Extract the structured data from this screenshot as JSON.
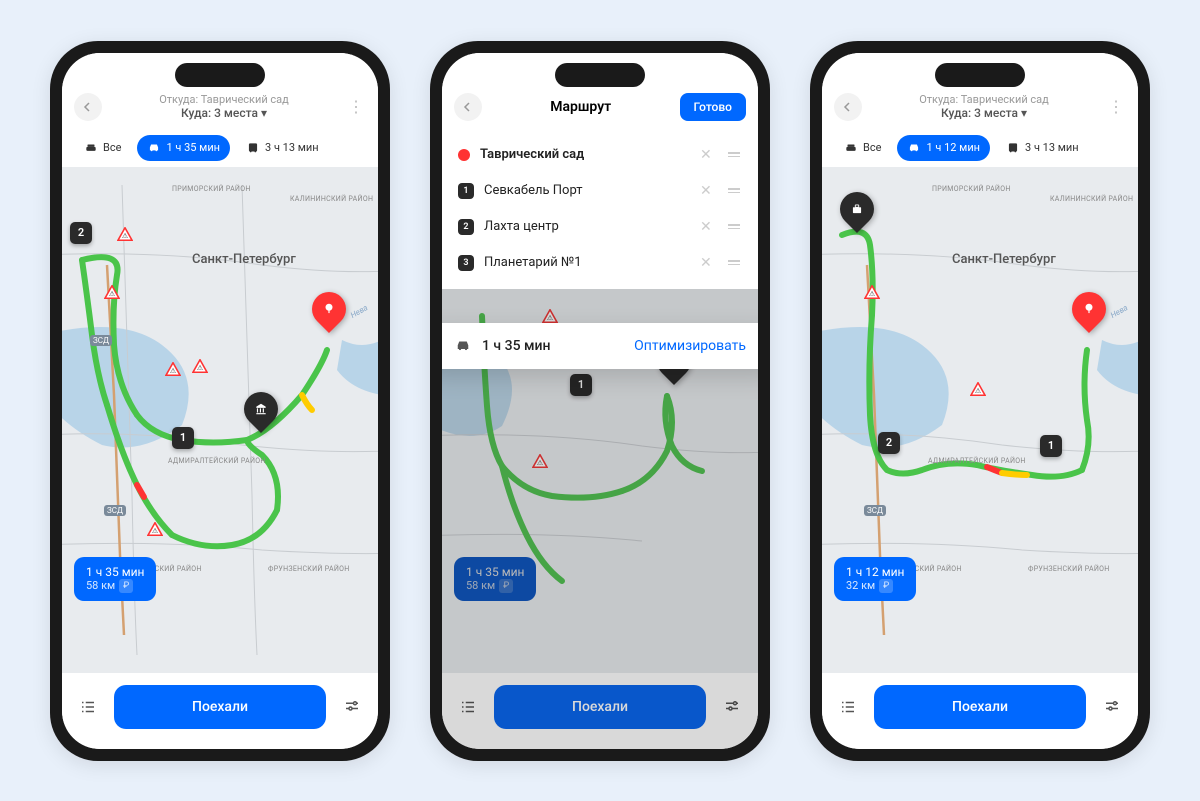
{
  "phoneA": {
    "header": {
      "from": "Откуда: Таврический сад",
      "to": "Куда: 3 места ▾"
    },
    "tabs": {
      "all": "Все",
      "car": "1 ч 35 мин",
      "bus": "3 ч 13 мин"
    },
    "city": "Санкт-Петербург",
    "districts": {
      "primorsky": "ПРИМОРСКИЙ РАЙОН",
      "kalinin": "КАЛИНИНСКИЙ РАЙОН",
      "admiral": "АДМИРАЛТЕЙСКИЙ РАЙОН",
      "kirov": "КИРОВСКИЙ РАЙОН",
      "frunz": "ФРУНЗЕНСКИЙ РАЙОН"
    },
    "roads": {
      "zsd": "ЗСД"
    },
    "river": "Нева",
    "summary": {
      "time": "1 ч 35 мин",
      "distance": "58 км",
      "ruble": "₽"
    },
    "go": "Поехали",
    "pins": {
      "one": "1",
      "two": "2"
    }
  },
  "phoneB": {
    "header": {
      "title": "Маршрут",
      "done": "Готово"
    },
    "stops": [
      {
        "name": "Таврический сад",
        "origin": true
      },
      {
        "num": "1",
        "name": "Севкабель Порт"
      },
      {
        "num": "2",
        "name": "Лахта центр"
      },
      {
        "num": "3",
        "name": "Планетарий №1"
      }
    ],
    "optimize": {
      "time": "1 ч 35 мин",
      "action": "Оптимизировать"
    },
    "summary": {
      "time": "1 ч 35 мин",
      "distance": "58 км",
      "ruble": "₽"
    },
    "go": "Поехали",
    "pins": {
      "one": "1"
    }
  },
  "phoneC": {
    "header": {
      "from": "Откуда: Таврический сад",
      "to": "Куда: 3 места ▾"
    },
    "tabs": {
      "all": "Все",
      "car": "1 ч 12 мин",
      "bus": "3 ч 13 мин"
    },
    "city": "Санкт-Петербург",
    "districts": {
      "primorsky": "ПРИМОРСКИЙ РАЙОН",
      "kalinin": "КАЛИНИНСКИЙ РАЙОН",
      "admiral": "АДМИРАЛТЕЙСКИЙ РАЙОН",
      "kirov": "КИРОВСКИЙ РАЙОН",
      "frunz": "ФРУНЗЕНСКИЙ РАЙОН"
    },
    "roads": {
      "zsd": "ЗСД"
    },
    "river": "Нева",
    "summary": {
      "time": "1 ч 12 мин",
      "distance": "32 км",
      "ruble": "₽"
    },
    "go": "Поехали",
    "pins": {
      "one": "1",
      "two": "2"
    }
  }
}
